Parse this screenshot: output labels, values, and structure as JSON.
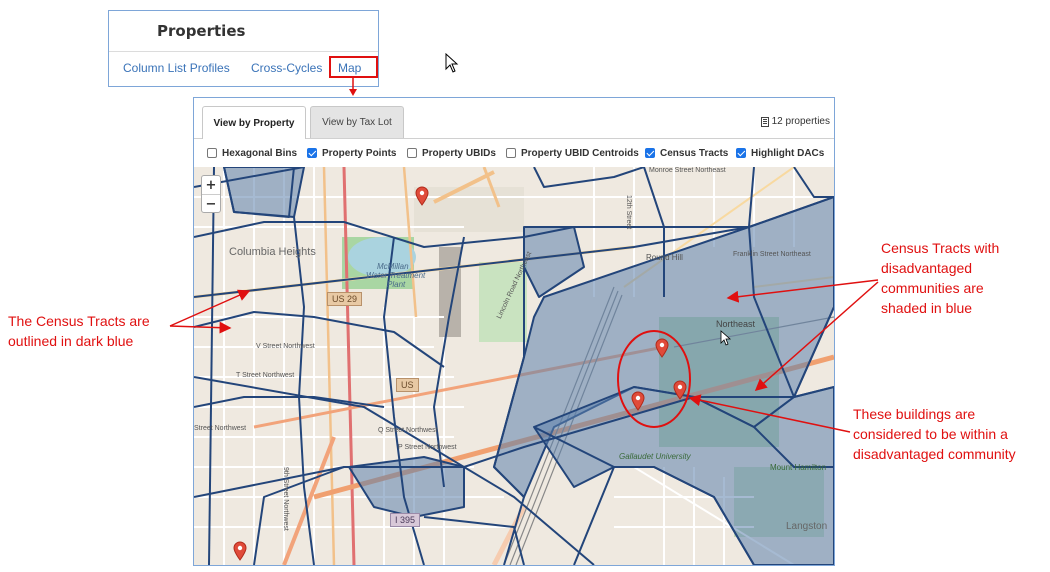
{
  "properties_panel": {
    "title": "Properties",
    "links": [
      "Column List Profiles",
      "Cross-Cycles",
      "Map"
    ]
  },
  "map_widget": {
    "tabs": [
      "View by Property",
      "View by Tax Lot"
    ],
    "property_count": "12 properties",
    "layers": [
      {
        "label": "Hexagonal Bins",
        "checked": false
      },
      {
        "label": "Property Points",
        "checked": true
      },
      {
        "label": "Property UBIDs",
        "checked": false
      },
      {
        "label": "Property UBID Centroids",
        "checked": false
      },
      {
        "label": "Census Tracts",
        "checked": true
      },
      {
        "label": "Highlight DACs",
        "checked": true
      }
    ],
    "zoom_in": "+",
    "zoom_out": "−",
    "map_labels": {
      "columbia_heights": "Columbia Heights",
      "mcmillan": "McMillan",
      "water_treatment": "Water Treatment",
      "plant": "Plant",
      "us29": "US 29",
      "us": "US",
      "i395": "I 395",
      "v_street": "V Street Northwest",
      "t_street": "T Street Northwest",
      "street_nw": "Street Northwest",
      "q_street": "Q Street Northwest",
      "p_street": "P Street Northwest",
      "ninth_street": "9th Street Northwest",
      "monroe_street": "Monroe Street Northeast",
      "franklin_street": "Franklin Street Northeast",
      "twelfth_street": "12th Street",
      "round_hill": "Round Hill",
      "northeast": "Northeast",
      "gallaudet": "Gallaudet University",
      "mount_hamilton": "Mount Hamilton",
      "langston": "Langston",
      "lincoln_road": "Lincoln Road Northeast"
    }
  },
  "annotations": {
    "census_outline": "The Census Tracts are outlined in dark blue",
    "disadvantaged_tracts": "Census Tracts with disadvantaged communities are shaded in blue",
    "buildings": "These buildings are considered to be within a disadvantaged community"
  },
  "colors": {
    "annotation_red": "#e01010",
    "tract_outline": "#23457a",
    "dac_fill": "#7d9bbf",
    "link_blue": "#3a73b8"
  }
}
